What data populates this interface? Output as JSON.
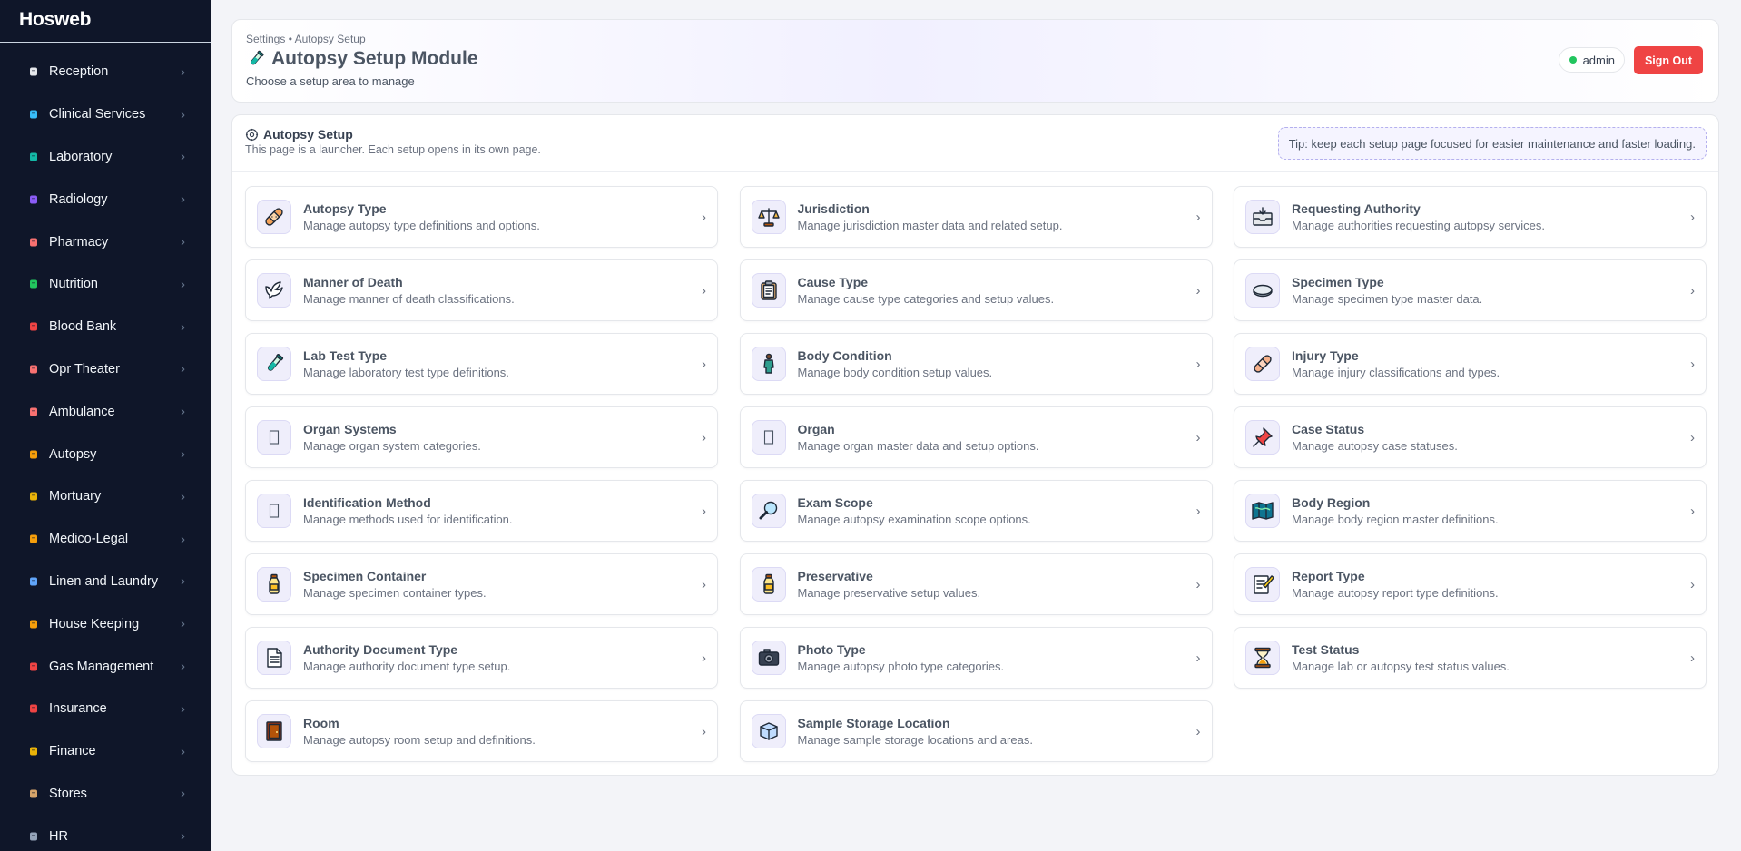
{
  "app": {
    "brand": "Hosweb"
  },
  "sidebar": {
    "items": [
      {
        "label": "Reception",
        "icon": "reception-icon"
      },
      {
        "label": "Clinical Services",
        "icon": "stethoscope-icon"
      },
      {
        "label": "Laboratory",
        "icon": "test-tube-icon"
      },
      {
        "label": "Radiology",
        "icon": "radiology-icon"
      },
      {
        "label": "Pharmacy",
        "icon": "pill-icon"
      },
      {
        "label": "Nutrition",
        "icon": "salad-icon"
      },
      {
        "label": "Blood Bank",
        "icon": "blood-drop-icon"
      },
      {
        "label": "Opr Theater",
        "icon": "hospital-icon"
      },
      {
        "label": "Ambulance",
        "icon": "ambulance-icon"
      },
      {
        "label": "Autopsy",
        "icon": "bandage-icon"
      },
      {
        "label": "Mortuary",
        "icon": "urn-icon"
      },
      {
        "label": "Medico-Legal",
        "icon": "scales-icon"
      },
      {
        "label": "Linen and Laundry",
        "icon": "laundry-icon"
      },
      {
        "label": "House Keeping",
        "icon": "broom-icon"
      },
      {
        "label": "Gas Management",
        "icon": "gas-cylinder-icon"
      },
      {
        "label": "Insurance",
        "icon": "shield-icon"
      },
      {
        "label": "Finance",
        "icon": "money-bag-icon"
      },
      {
        "label": "Stores",
        "icon": "box-icon"
      },
      {
        "label": "HR",
        "icon": "people-icon"
      }
    ]
  },
  "header": {
    "breadcrumb": "Settings • Autopsy Setup",
    "title": "Autopsy Setup Module",
    "subtitle": "Choose a setup area to manage",
    "user": "admin",
    "signout_label": "Sign Out",
    "status_color": "#22c55e",
    "accent_color": "#ef4444"
  },
  "panel": {
    "title": "Autopsy Setup",
    "description": "This page is a launcher. Each setup opens in its own page.",
    "tip": "Tip: keep each setup page focused for easier maintenance and faster loading."
  },
  "cards": [
    {
      "name": "Autopsy Type",
      "desc": "Manage autopsy type definitions and options.",
      "icon": "bandage-icon"
    },
    {
      "name": "Jurisdiction",
      "desc": "Manage jurisdiction master data and related setup.",
      "icon": "scales-icon"
    },
    {
      "name": "Requesting Authority",
      "desc": "Manage authorities requesting autopsy services.",
      "icon": "inbox-tray-icon"
    },
    {
      "name": "Manner of Death",
      "desc": "Manage manner of death classifications.",
      "icon": "dove-icon"
    },
    {
      "name": "Cause Type",
      "desc": "Manage cause type categories and setup values.",
      "icon": "clipboard-icon"
    },
    {
      "name": "Specimen Type",
      "desc": "Manage specimen type master data.",
      "icon": "petri-dish-icon"
    },
    {
      "name": "Lab Test Type",
      "desc": "Manage laboratory test type definitions.",
      "icon": "test-tube-icon"
    },
    {
      "name": "Body Condition",
      "desc": "Manage body condition setup values.",
      "icon": "person-standing-icon"
    },
    {
      "name": "Injury Type",
      "desc": "Manage injury classifications and types.",
      "icon": "adhesive-bandage-icon"
    },
    {
      "name": "Organ Systems",
      "desc": "Manage organ system categories.",
      "icon": "missing-glyph-icon"
    },
    {
      "name": "Organ",
      "desc": "Manage organ master data and setup options.",
      "icon": "missing-glyph-icon"
    },
    {
      "name": "Case Status",
      "desc": "Manage autopsy case statuses.",
      "icon": "pushpin-icon"
    },
    {
      "name": "Identification Method",
      "desc": "Manage methods used for identification.",
      "icon": "missing-glyph-icon"
    },
    {
      "name": "Exam Scope",
      "desc": "Manage autopsy examination scope options.",
      "icon": "magnifier-icon"
    },
    {
      "name": "Body Region",
      "desc": "Manage body region master definitions.",
      "icon": "map-icon"
    },
    {
      "name": "Specimen Container",
      "desc": "Manage specimen container types.",
      "icon": "bottle-icon"
    },
    {
      "name": "Preservative",
      "desc": "Manage preservative setup values.",
      "icon": "bottle-icon"
    },
    {
      "name": "Report Type",
      "desc": "Manage autopsy report type definitions.",
      "icon": "memo-icon"
    },
    {
      "name": "Authority Document Type",
      "desc": "Manage authority document type setup.",
      "icon": "document-icon"
    },
    {
      "name": "Photo Type",
      "desc": "Manage autopsy photo type categories.",
      "icon": "camera-icon"
    },
    {
      "name": "Test Status",
      "desc": "Manage lab or autopsy test status values.",
      "icon": "hourglass-icon"
    },
    {
      "name": "Room",
      "desc": "Manage autopsy room setup and definitions.",
      "icon": "door-icon"
    },
    {
      "name": "Sample Storage Location",
      "desc": "Manage sample storage locations and areas.",
      "icon": "ice-cube-icon"
    }
  ]
}
